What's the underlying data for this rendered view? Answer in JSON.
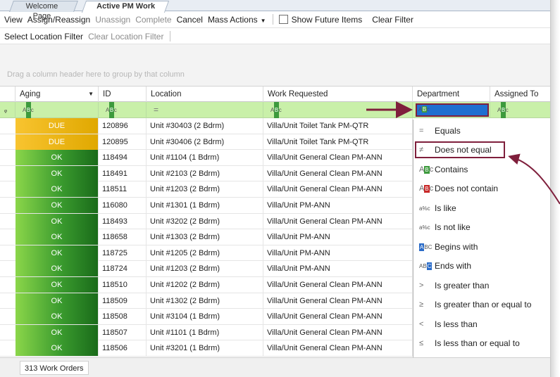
{
  "tabs": [
    {
      "label": "Welcome Page",
      "active": false
    },
    {
      "label": "Active PM Work",
      "active": true
    }
  ],
  "toolbar1": {
    "view": "View",
    "assign": "Assign/Reassign",
    "unassign": "Unassign",
    "complete": "Complete",
    "cancel": "Cancel",
    "mass_actions": "Mass Actions",
    "show_future": "Show Future Items",
    "clear_filter": "Clear Filter"
  },
  "toolbar2": {
    "select_location": "Select Location Filter",
    "clear_location": "Clear Location Filter"
  },
  "group_hint": "Drag a column header here to group by that column",
  "columns": [
    "Aging",
    "ID",
    "Location",
    "Work Requested",
    "Department",
    "Assigned To"
  ],
  "rows": [
    {
      "aging": "DUE",
      "id": "120896",
      "location": "Unit #30403 (2 Bdrm)",
      "work": "Villa/Unit Toilet Tank PM-QTR"
    },
    {
      "aging": "DUE",
      "id": "120895",
      "location": "Unit #30406 (2 Bdrm)",
      "work": "Villa/Unit Toilet Tank PM-QTR"
    },
    {
      "aging": "OK",
      "id": "118494",
      "location": "Unit #1104 (1 Bdrm)",
      "work": "Villa/Unit General Clean PM-ANN"
    },
    {
      "aging": "OK",
      "id": "118491",
      "location": "Unit #2103 (2 Bdrm)",
      "work": "Villa/Unit General Clean PM-ANN"
    },
    {
      "aging": "OK",
      "id": "118511",
      "location": "Unit #1203 (2 Bdrm)",
      "work": "Villa/Unit General Clean PM-ANN"
    },
    {
      "aging": "OK",
      "id": "116080",
      "location": "Unit #1301 (1 Bdrm)",
      "work": "Villa/Unit PM-ANN"
    },
    {
      "aging": "OK",
      "id": "118493",
      "location": "Unit #3202 (2 Bdrm)",
      "work": "Villa/Unit General Clean PM-ANN"
    },
    {
      "aging": "OK",
      "id": "118658",
      "location": "Unit #1303 (2 Bdrm)",
      "work": "Villa/Unit PM-ANN"
    },
    {
      "aging": "OK",
      "id": "118725",
      "location": "Unit #1205 (2 Bdrm)",
      "work": "Villa/Unit PM-ANN"
    },
    {
      "aging": "OK",
      "id": "118724",
      "location": "Unit #1203 (2 Bdrm)",
      "work": "Villa/Unit PM-ANN"
    },
    {
      "aging": "OK",
      "id": "118510",
      "location": "Unit #1202 (2 Bdrm)",
      "work": "Villa/Unit General Clean PM-ANN"
    },
    {
      "aging": "OK",
      "id": "118509",
      "location": "Unit #1302 (2 Bdrm)",
      "work": "Villa/Unit General Clean PM-ANN"
    },
    {
      "aging": "OK",
      "id": "118508",
      "location": "Unit #3104 (1 Bdrm)",
      "work": "Villa/Unit General Clean PM-ANN"
    },
    {
      "aging": "OK",
      "id": "118507",
      "location": "Unit #1101 (1 Bdrm)",
      "work": "Villa/Unit General Clean PM-ANN"
    },
    {
      "aging": "OK",
      "id": "118506",
      "location": "Unit #3201 (1 Bdrm)",
      "work": "Villa/Unit General Clean PM-ANN"
    }
  ],
  "filter_operators": [
    {
      "label": "Equals",
      "icon": "equals-icon",
      "glyph": "="
    },
    {
      "label": "Does not equal",
      "icon": "not-equal-icon",
      "glyph": "≠"
    },
    {
      "label": "Contains",
      "icon": "contains-icon",
      "glyph": "AB c"
    },
    {
      "label": "Does not contain",
      "icon": "does-not-contain-icon",
      "glyph": "AB c"
    },
    {
      "label": "Is like",
      "icon": "is-like-icon",
      "glyph": "a%c"
    },
    {
      "label": "Is not like",
      "icon": "is-not-like-icon",
      "glyph": "a%c"
    },
    {
      "label": "Begins with",
      "icon": "begins-with-icon",
      "glyph": "ABC"
    },
    {
      "label": "Ends with",
      "icon": "ends-with-icon",
      "glyph": "ABC"
    },
    {
      "label": "Is greater than",
      "icon": "greater-than-icon",
      "glyph": ">"
    },
    {
      "label": "Is greater than or equal to",
      "icon": "greater-equal-icon",
      "glyph": "≥"
    },
    {
      "label": "Is less than",
      "icon": "less-than-icon",
      "glyph": "<"
    },
    {
      "label": "Is less than or equal to",
      "icon": "less-equal-icon",
      "glyph": "≤"
    }
  ],
  "status": {
    "count": "313 Work Orders"
  },
  "colors": {
    "due": "#f8c430",
    "ok": "#3a9b2e",
    "filter_row": "#c9f0a9",
    "annotation": "#7f1f3c"
  }
}
